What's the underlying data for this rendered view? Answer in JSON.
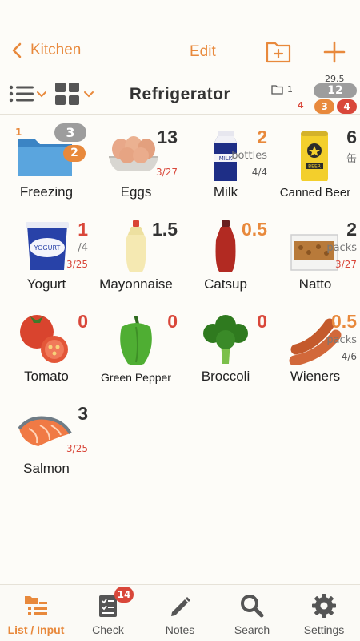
{
  "nav": {
    "back_label": "Kitchen",
    "edit_label": "Edit"
  },
  "toolbar": {
    "title": "Refrigerator",
    "folder_count": "1",
    "expired_count": "4",
    "total_quantity": "29.5",
    "items_count": "12",
    "warning_count": "3",
    "alert_count": "4"
  },
  "items": [
    {
      "name": "Freezing",
      "folder_count": "3",
      "warning": "2",
      "expired": "1"
    },
    {
      "name": "Eggs",
      "qty": "13",
      "sub": "3/27"
    },
    {
      "name": "Milk",
      "qty": "2",
      "unit": "bottles",
      "sub": "4/4"
    },
    {
      "name": "Canned Beer",
      "qty": "6",
      "unit": "缶"
    },
    {
      "name": "Yogurt",
      "qty": "1",
      "unit": "/4",
      "sub": "3/25"
    },
    {
      "name": "Mayonnaise",
      "qty": "1.5"
    },
    {
      "name": "Catsup",
      "qty": "0.5"
    },
    {
      "name": "Natto",
      "qty": "2",
      "unit": "packs",
      "sub": "3/27"
    },
    {
      "name": "Tomato",
      "qty": "0"
    },
    {
      "name": "Green Pepper",
      "qty": "0"
    },
    {
      "name": "Broccoli",
      "qty": "0"
    },
    {
      "name": "Wieners",
      "qty": "0.5",
      "unit": "packs",
      "sub": "4/6"
    },
    {
      "name": "Salmon",
      "qty": "3",
      "sub": "3/25"
    }
  ],
  "tabs": [
    {
      "label": "List / Input",
      "icon": "list-input-icon"
    },
    {
      "label": "Check",
      "icon": "checklist-icon",
      "badge": "14"
    },
    {
      "label": "Notes",
      "icon": "pencil-icon"
    },
    {
      "label": "Search",
      "icon": "search-icon"
    },
    {
      "label": "Settings",
      "icon": "gear-icon"
    }
  ],
  "colors": {
    "accent": "#e8893c",
    "alert": "#d9473a",
    "neutral_badge": "#9d9d9d"
  }
}
